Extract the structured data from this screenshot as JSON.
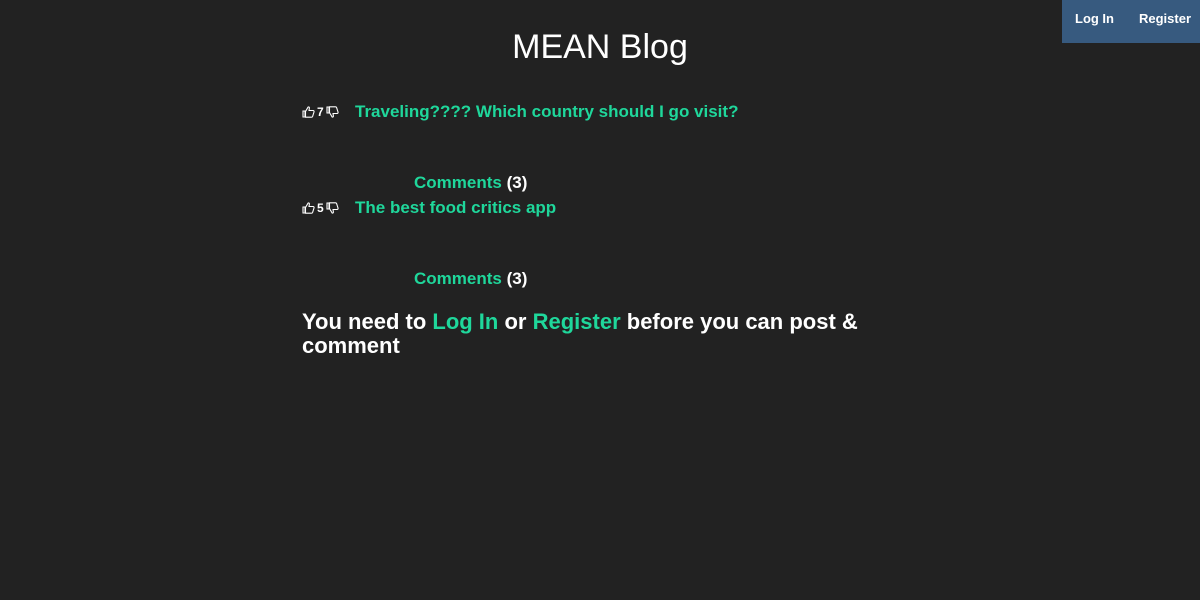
{
  "nav": {
    "login_label": "Log In",
    "register_label": "Register"
  },
  "page": {
    "title": "MEAN Blog"
  },
  "posts": [
    {
      "votes": "7",
      "title": "Traveling???? Which country should I go visit?",
      "comments_label": "Comments",
      "comments_count": "(3)"
    },
    {
      "votes": "5",
      "title": "The best food critics app",
      "comments_label": "Comments",
      "comments_count": "(3)"
    }
  ],
  "notice": {
    "prefix": "You need to ",
    "login_link": "Log In",
    "middle": " or ",
    "register_link": "Register",
    "suffix": " before you can post & comment"
  },
  "colors": {
    "background": "#222222",
    "accent": "#1fd79b",
    "navbar": "#375a7f"
  },
  "icons": [
    "thumbs-up-icon",
    "thumbs-down-icon"
  ]
}
